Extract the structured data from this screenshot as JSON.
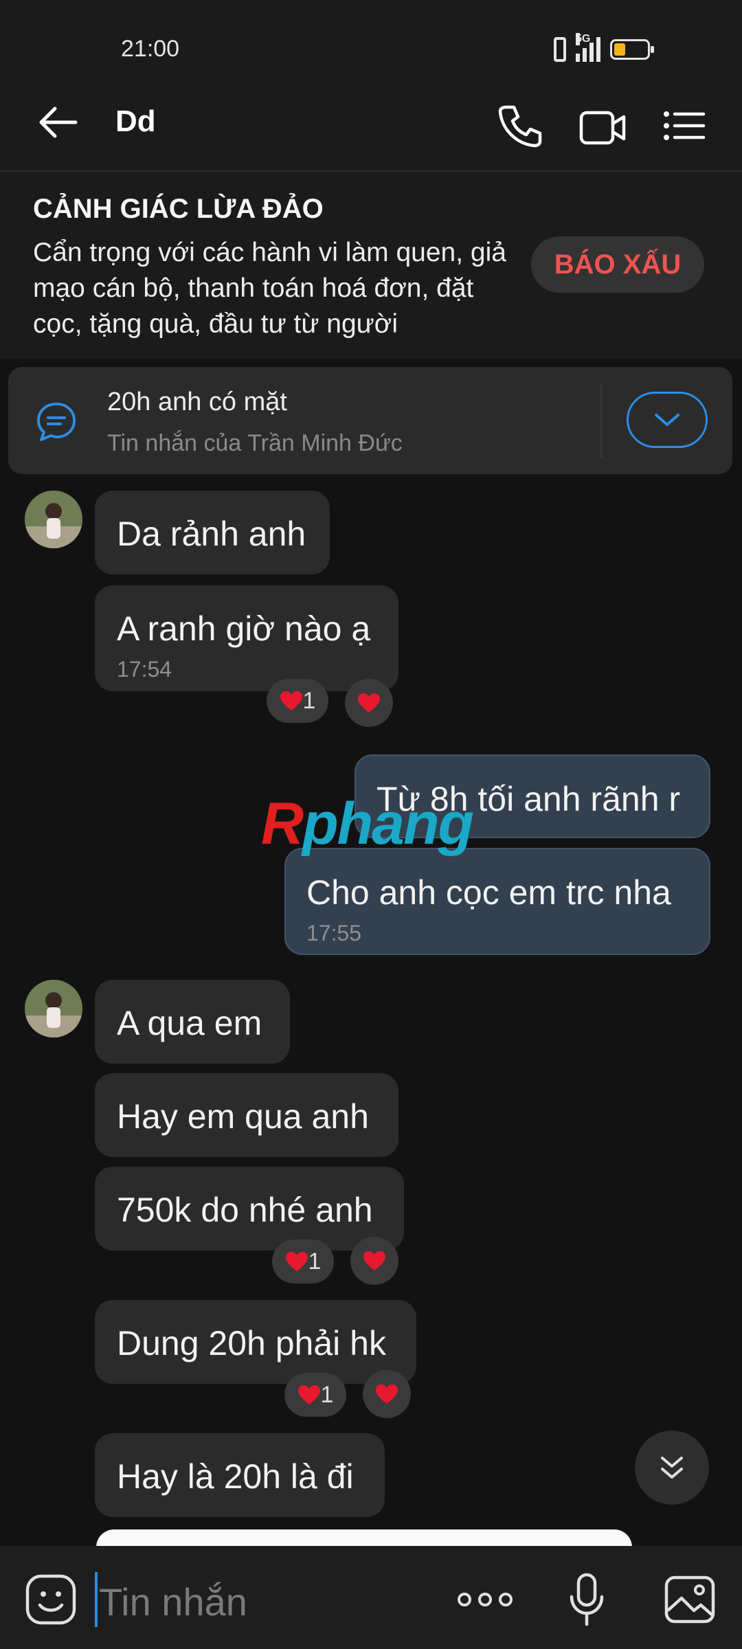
{
  "status_bar": {
    "time": "21:00",
    "network_label": "5G",
    "battery_level_fraction": 0.35,
    "battery_color": "#f3b51b",
    "icons": [
      "vibrate-icon",
      "signal-icon",
      "battery-icon"
    ]
  },
  "header": {
    "contact_name": "Dd",
    "icons": [
      "back-arrow-icon",
      "phone-icon",
      "video-camera-icon",
      "list-menu-icon"
    ]
  },
  "warning": {
    "title": "CẢNH GIÁC LỪA ĐẢO",
    "body": "Cẩn trọng với các hành vi làm quen, giả mạo cán bộ, thanh toán hoá đơn, đặt cọc, tặng quà, đầu tư từ người",
    "report_label": "BÁO XẤU",
    "report_color": "#ef5350"
  },
  "pinned": {
    "text": "20h anh có mặt",
    "subtitle": "Tin nhắn của Trần Minh Đức",
    "icon": "chat-bubble-icon",
    "accent": "#2b8de6"
  },
  "messages": [
    {
      "direction": "in",
      "text": "Da rảnh anh"
    },
    {
      "direction": "in",
      "text": "A ranh giờ nào ạ",
      "time": "17:54",
      "reaction_count": "1"
    },
    {
      "direction": "out",
      "text": "Từ 8h tối anh rãnh r"
    },
    {
      "direction": "out",
      "text": "Cho anh cọc em trc nha",
      "time": "17:55"
    },
    {
      "direction": "in",
      "text": "A qua em"
    },
    {
      "direction": "in",
      "text": "Hay em qua anh"
    },
    {
      "direction": "in",
      "text": "750k do nhé anh",
      "reaction_count": "1"
    },
    {
      "direction": "in",
      "text": "Dung 20h phải hk",
      "reaction_count": "1"
    },
    {
      "direction": "in",
      "text": "Hay là 20h là đi"
    }
  ],
  "watermark": {
    "part1": "R",
    "part2": "phang"
  },
  "input_bar": {
    "placeholder": "Tin nhắn",
    "icons": [
      "sticker-icon",
      "more-dots-icon",
      "microphone-icon",
      "image-gallery-icon"
    ]
  },
  "colors": {
    "background": "#121212",
    "incoming_bubble": "#2b2b2b",
    "outgoing_bubble": "#33404f",
    "reaction_heart": "#e8182f"
  }
}
